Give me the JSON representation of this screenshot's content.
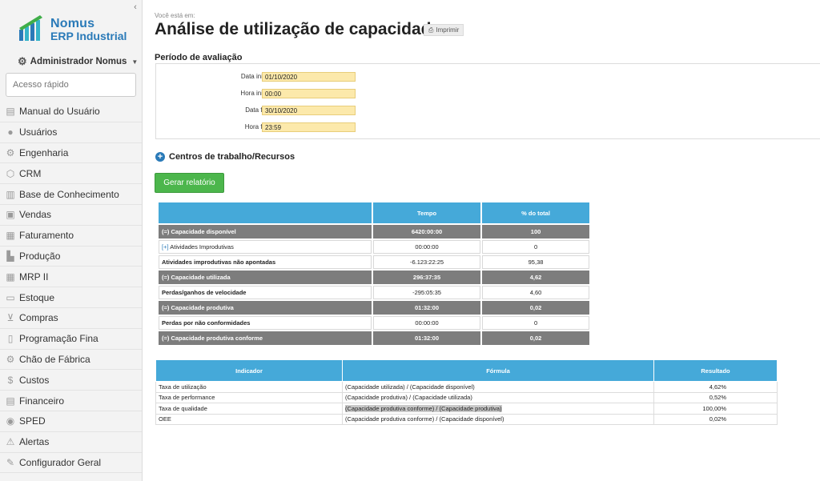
{
  "sidebar": {
    "logo_line1": "Nomus",
    "logo_line2": "ERP Industrial",
    "user": "Administrador Nomus",
    "quick_placeholder": "Acesso rápido",
    "items": [
      {
        "label": "Manual do Usuário",
        "icon": "book-icon"
      },
      {
        "label": "Usuários",
        "icon": "user-icon"
      },
      {
        "label": "Engenharia",
        "icon": "gear-icon"
      },
      {
        "label": "CRM",
        "icon": "crm-icon"
      },
      {
        "label": "Base de Conhecimento",
        "icon": "library-icon"
      },
      {
        "label": "Vendas",
        "icon": "cash-register-icon"
      },
      {
        "label": "Faturamento",
        "icon": "invoice-icon"
      },
      {
        "label": "Produção",
        "icon": "factory-icon"
      },
      {
        "label": "MRP II",
        "icon": "grid-icon"
      },
      {
        "label": "Estoque",
        "icon": "box-icon"
      },
      {
        "label": "Compras",
        "icon": "cart-icon"
      },
      {
        "label": "Programação Fina",
        "icon": "calendar-icon"
      },
      {
        "label": "Chão de Fábrica",
        "icon": "gears-icon"
      },
      {
        "label": "Custos",
        "icon": "dollar-icon"
      },
      {
        "label": "Financeiro",
        "icon": "ledger-icon"
      },
      {
        "label": "SPED",
        "icon": "database-icon"
      },
      {
        "label": "Alertas",
        "icon": "warning-icon"
      },
      {
        "label": "Configurador Geral",
        "icon": "wrench-icon"
      }
    ]
  },
  "main": {
    "breadcrumb": "Você está em:",
    "title": "Análise de utilização de capacidade",
    "print_label": "Imprimir",
    "period_title": "Período de avaliação",
    "fields": [
      {
        "label": "Data inicial",
        "value": "01/10/2020"
      },
      {
        "label": "Hora inicial",
        "value": "00:00"
      },
      {
        "label": "Data final",
        "value": "30/10/2020"
      },
      {
        "label": "Hora final",
        "value": "23:59"
      }
    ],
    "centros_label": "Centros de trabalho/Recursos",
    "generate_label": "Gerar relatório"
  },
  "table1": {
    "headers": [
      "",
      "Tempo",
      "% do total"
    ],
    "rows": [
      {
        "label": "(=) Capacidade disponível",
        "tempo": "6420:00:00",
        "pct": "100"
      },
      {
        "prefix": "[+]",
        "label": "Atividades Improdutivas",
        "tempo": "00:00:00",
        "pct": "0"
      },
      {
        "label": "Atividades improdutivas não apontadas",
        "tempo": "-6.123:22:25",
        "pct": "95,38"
      },
      {
        "label": "(=) Capacidade utilizada",
        "tempo": "296:37:35",
        "pct": "4,62"
      },
      {
        "label": "Perdas/ganhos de velocidade",
        "tempo": "-295:05:35",
        "pct": "4,60"
      },
      {
        "label": "(=) Capacidade produtiva",
        "tempo": "01:32:00",
        "pct": "0,02"
      },
      {
        "label": "Perdas por não conformidades",
        "tempo": "00:00:00",
        "pct": "0"
      },
      {
        "label": "(=) Capacidade produtiva conforme",
        "tempo": "01:32:00",
        "pct": "0,02"
      }
    ]
  },
  "table2": {
    "headers": [
      "Indicador",
      "Fórmula",
      "Resultado"
    ],
    "rows": [
      {
        "ind": "Taxa de utilização",
        "form": "(Capacidade utilizada) / (Capacidade disponível)",
        "res": "4,62%"
      },
      {
        "ind": "Taxa de performance",
        "form": "(Capacidade produtiva) / (Capacidade utilizada)",
        "res": "0,52%"
      },
      {
        "ind": "Taxa de qualidade",
        "form": "(Capacidade produtiva conforme) / (Capacidade produtiva)",
        "res": "100,00%"
      },
      {
        "ind": "OEE",
        "form": "(Capacidade produtiva conforme) / (Capacidade disponível)",
        "res": "0,02%"
      }
    ]
  },
  "colors": {
    "accent": "#45a9d9",
    "brand": "#2a7ab8",
    "gray_row": "#7d7d7d",
    "field_bg": "#fce9ab",
    "generate": "#4cb64c"
  }
}
